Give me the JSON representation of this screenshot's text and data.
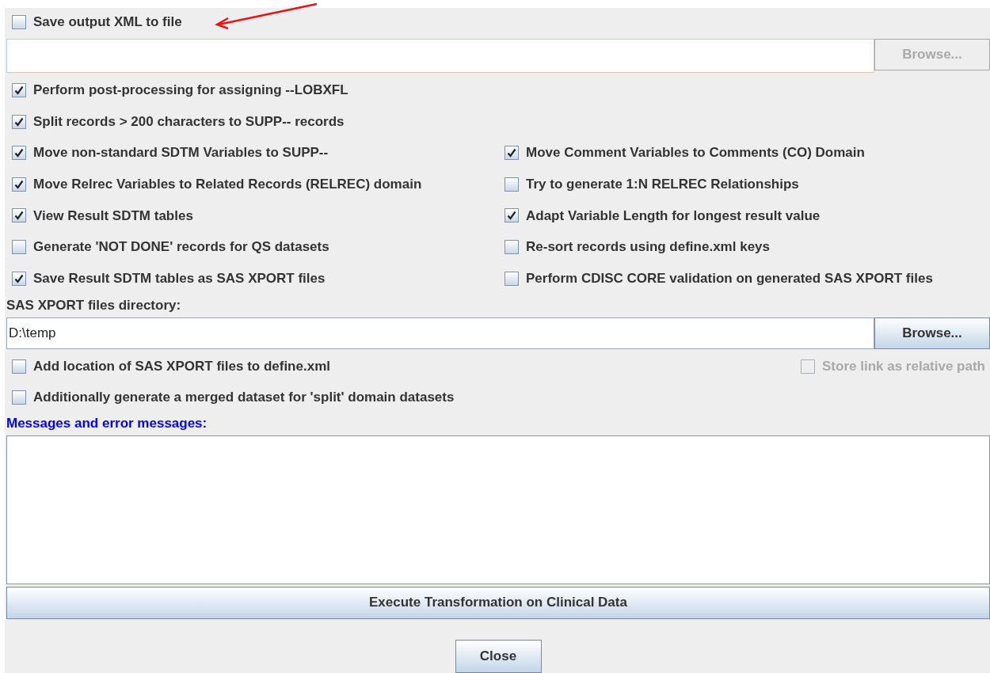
{
  "save_xml": {
    "label": "Save output XML to file",
    "checked": false
  },
  "xml_browse": {
    "label": "Browse...",
    "disabled": true
  },
  "option_rows": [
    [
      {
        "label": "Perform post-processing for assigning --LOBXFL",
        "checked": true
      }
    ],
    [
      {
        "label": "Split records > 200 characters to SUPP-- records",
        "checked": true
      }
    ],
    [
      {
        "label": "Move non-standard SDTM Variables to SUPP--",
        "checked": true
      },
      {
        "label": "Move Comment Variables to Comments (CO) Domain",
        "checked": true
      }
    ],
    [
      {
        "label": "Move Relrec Variables to Related Records (RELREC) domain",
        "checked": true
      },
      {
        "label": "Try to generate 1:N RELREC Relationships",
        "checked": false
      }
    ],
    [
      {
        "label": "View Result SDTM tables",
        "checked": true
      },
      {
        "label": "Adapt Variable Length for longest result value",
        "checked": true
      }
    ],
    [
      {
        "label": "Generate 'NOT DONE' records for QS datasets",
        "checked": false
      },
      {
        "label": "Re-sort records using define.xml keys",
        "checked": false
      }
    ],
    [
      {
        "label": "Save Result SDTM tables as SAS XPORT files",
        "checked": true
      },
      {
        "label": "Perform CDISC CORE validation on generated SAS XPORT files",
        "checked": false
      }
    ]
  ],
  "xport_dir": {
    "label": "SAS XPORT files directory:",
    "value": "D:\\temp"
  },
  "xport_browse": {
    "label": "Browse...",
    "disabled": false
  },
  "xport_options": [
    {
      "label": "Add location of SAS XPORT files to define.xml",
      "checked": false,
      "disabled": false
    },
    {
      "label": "Store link as relative path",
      "checked": false,
      "disabled": true
    }
  ],
  "merged_option": {
    "label": "Additionally generate a merged dataset for 'split' domain datasets",
    "checked": false
  },
  "messages_label": "Messages and error messages:",
  "execute_button": "Execute Transformation on Clinical Data",
  "close_button": "Close"
}
